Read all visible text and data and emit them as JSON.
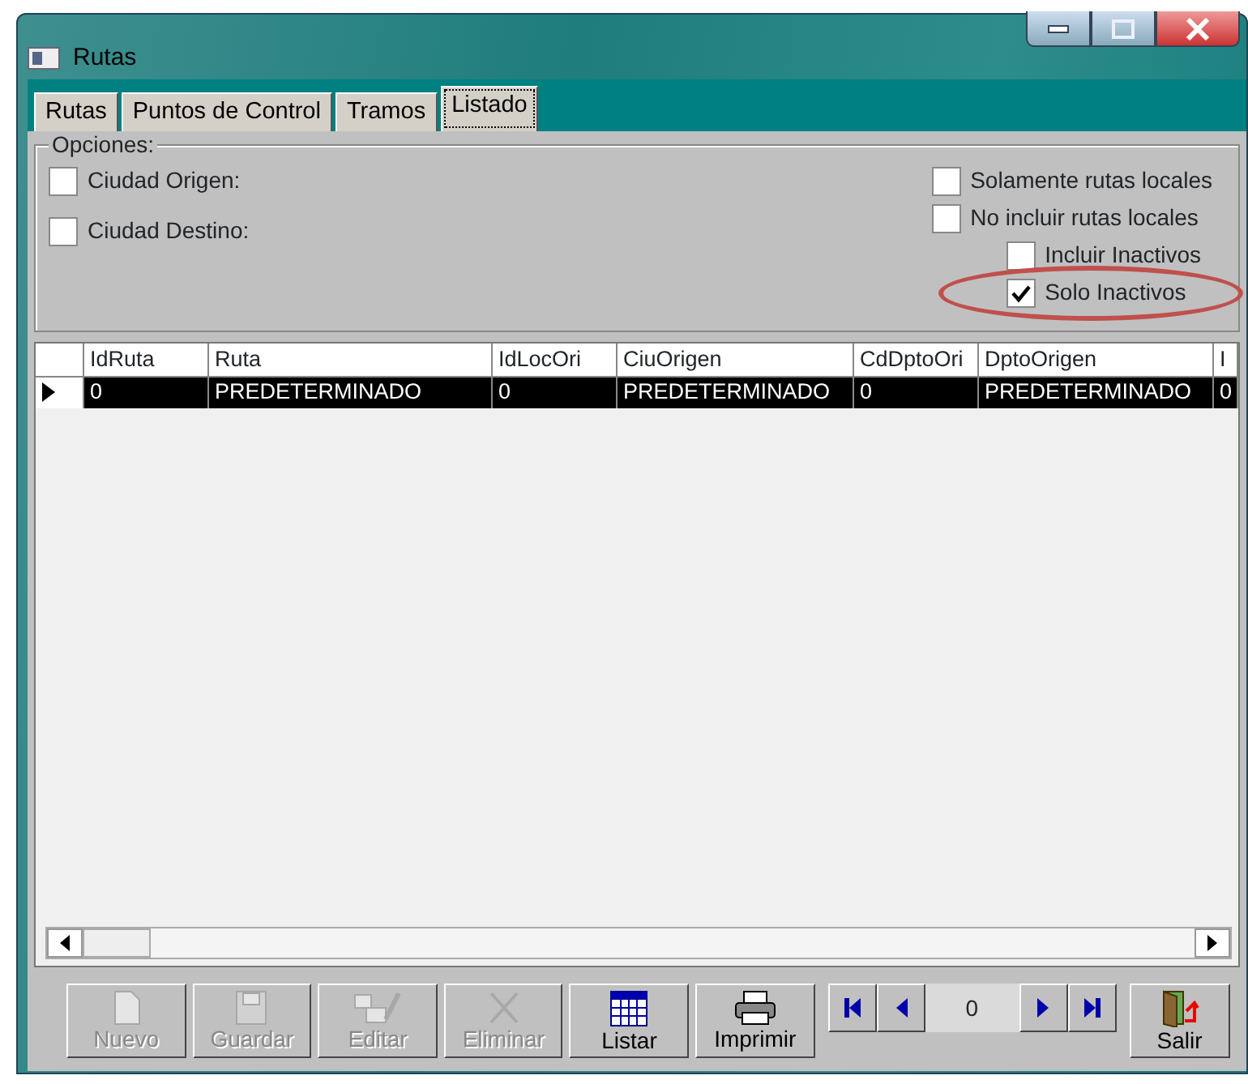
{
  "window": {
    "title": "Rutas"
  },
  "tabs": [
    {
      "label": "Rutas",
      "selected": false
    },
    {
      "label": "Puntos de Control",
      "selected": false
    },
    {
      "label": "Tramos",
      "selected": false
    },
    {
      "label": "Listado",
      "selected": true
    }
  ],
  "options": {
    "legend": "Opciones:",
    "left": [
      {
        "label": "Ciudad Origen:",
        "checked": false
      },
      {
        "label": "Ciudad Destino:",
        "checked": false
      }
    ],
    "right": [
      {
        "label": "Solamente rutas locales",
        "checked": false,
        "indented": false,
        "circled": false
      },
      {
        "label": "No incluir rutas locales",
        "checked": false,
        "indented": false,
        "circled": false
      },
      {
        "label": "Incluir Inactivos",
        "checked": false,
        "indented": true,
        "circled": false
      },
      {
        "label": "Solo Inactivos",
        "checked": true,
        "indented": true,
        "circled": true
      }
    ]
  },
  "table": {
    "columns": [
      "IdRuta",
      "Ruta",
      "IdLocOri",
      "CiuOrigen",
      "CdDptoOri",
      "DptoOrigen",
      "I"
    ],
    "rows": [
      {
        "current": true,
        "selected": true,
        "cells": [
          "0",
          "PREDETERMINADO",
          "0",
          "PREDETERMINADO",
          "0",
          "PREDETERMINADO",
          "0"
        ]
      }
    ]
  },
  "toolbar": {
    "buttons": [
      {
        "label": "Nuevo",
        "disabled": true
      },
      {
        "label": "Guardar",
        "disabled": true
      },
      {
        "label": "Editar",
        "disabled": true
      },
      {
        "label": "Eliminar",
        "disabled": true
      },
      {
        "label": "Listar",
        "disabled": false
      },
      {
        "label": "Imprimir",
        "disabled": false
      }
    ],
    "navigator": {
      "value": "0"
    },
    "exit": {
      "label": "Salir",
      "disabled": false
    }
  }
}
